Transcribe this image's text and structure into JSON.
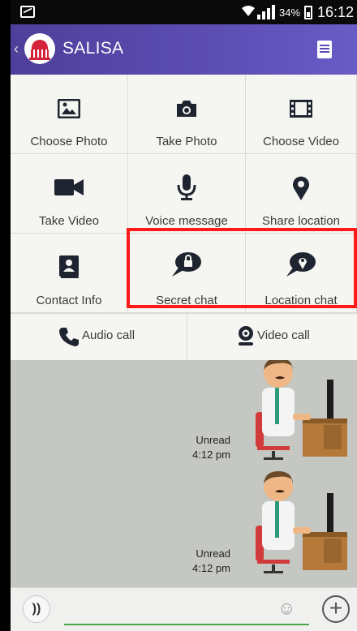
{
  "status_bar": {
    "battery_percent": "34%",
    "time": "16:12"
  },
  "header": {
    "title": "SALISA"
  },
  "attach_panel": {
    "items": [
      {
        "label": "Choose Photo",
        "icon": "image-icon"
      },
      {
        "label": "Take Photo",
        "icon": "camera-icon"
      },
      {
        "label": "Choose Video",
        "icon": "film-icon"
      },
      {
        "label": "Take Video",
        "icon": "video-camera-icon"
      },
      {
        "label": "Voice message",
        "icon": "microphone-icon"
      },
      {
        "label": "Share location",
        "icon": "map-pin-icon"
      },
      {
        "label": "Contact Info",
        "icon": "contact-book-icon"
      },
      {
        "label": "Secret chat",
        "icon": "secret-chat-lock-icon"
      },
      {
        "label": "Location chat",
        "icon": "location-chat-icon"
      }
    ],
    "calls": [
      {
        "label": "Audio call",
        "icon": "phone-icon"
      },
      {
        "label": "Video call",
        "icon": "webcam-icon"
      }
    ]
  },
  "chat": {
    "messages": [
      {
        "status": "Unread",
        "time": "4:12 pm"
      },
      {
        "status": "Unread",
        "time": "4:12 pm"
      }
    ]
  },
  "input_bar": {
    "placeholder": ""
  },
  "colors": {
    "header_gradient_start": "#4f3f9a",
    "header_gradient_end": "#6a5cc6",
    "icon_color": "#1f2530",
    "input_underline": "#4aa64a",
    "annotation_red": "#ff1a1a"
  }
}
